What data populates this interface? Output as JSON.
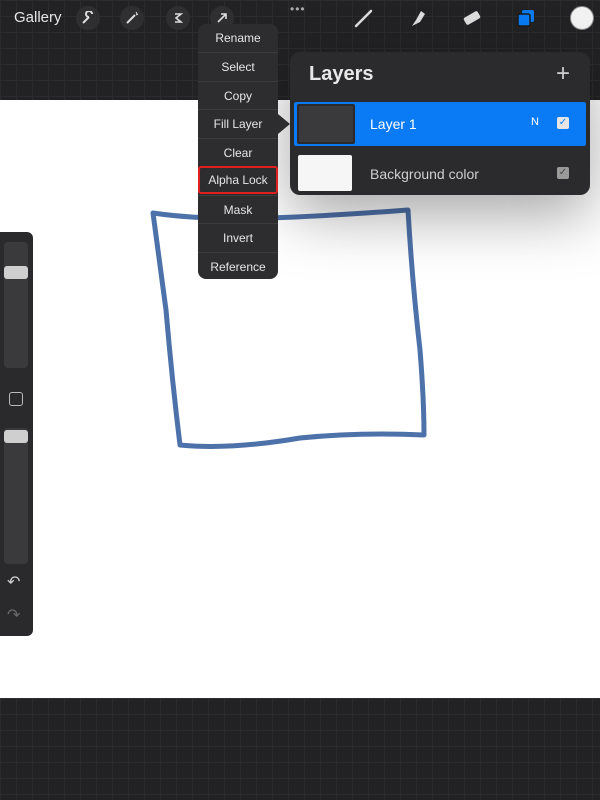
{
  "toolbar": {
    "gallery_label": "Gallery",
    "icons": [
      "wrench-icon",
      "magic-wand-icon",
      "selection-icon",
      "transform-arrow-icon",
      "more-dots-icon",
      "brush-icon",
      "smudge-icon",
      "eraser-icon",
      "layers-icon",
      "color-icon"
    ],
    "dots": "•••",
    "accent": "#0a7bf5"
  },
  "layers": {
    "title": "Layers",
    "add_label": "+",
    "items": [
      {
        "name": "Layer 1",
        "blend": "N",
        "visible": true
      },
      {
        "name": "Background color",
        "visible": true
      }
    ]
  },
  "menu": {
    "items": [
      "Rename",
      "Select",
      "Copy",
      "Fill Layer",
      "Clear",
      "Alpha Lock",
      "Mask",
      "Invert",
      "Reference"
    ],
    "highlighted": "Alpha Lock"
  },
  "sidebar": {
    "undo": "↶",
    "redo": "↷",
    "brush_size_level": 0.2,
    "opacity_level": 0.0
  },
  "canvas": {
    "stroke_color": "#3a62a0"
  }
}
